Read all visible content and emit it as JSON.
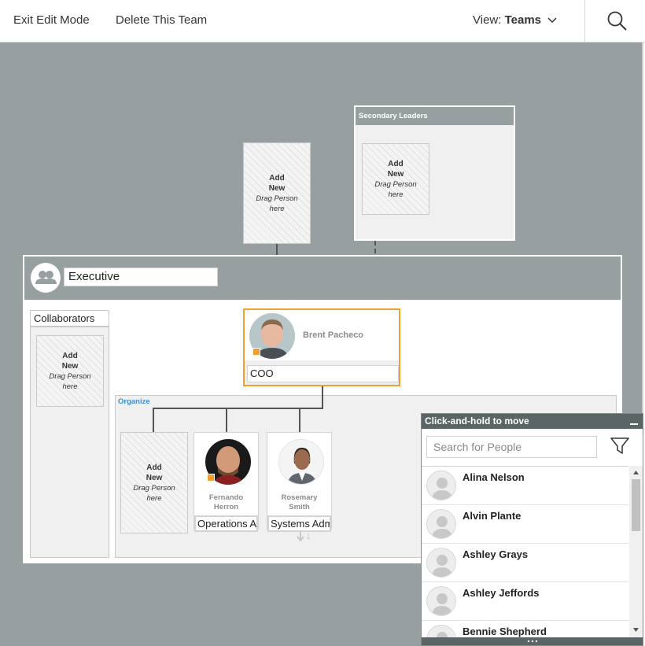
{
  "toolbar": {
    "exit_edit_label": "Exit Edit Mode",
    "delete_team_label": "Delete This Team",
    "view_prefix": "View:",
    "view_value": "Teams"
  },
  "placeholder": {
    "add": "Add",
    "new": "New",
    "drag_line1": "Drag Person",
    "drag_line2": "here"
  },
  "secondary_leaders": {
    "title": "Secondary Leaders"
  },
  "team": {
    "name": "Executive"
  },
  "collaborators": {
    "title": "Collaborators"
  },
  "leader": {
    "name": "Brent Pacheco",
    "role": "COO"
  },
  "organize": {
    "title": "Organize"
  },
  "members": [
    {
      "name_line1": "Fernando",
      "name_line2": "Herron",
      "role": "Operations Assistant"
    },
    {
      "name_line1": "Rosemary",
      "name_line2": "Smith",
      "role": "Systems Administrator",
      "reports_count": "1"
    }
  ],
  "people_panel": {
    "header": "Click-and-hold to move",
    "search_placeholder": "Search for People",
    "people": [
      {
        "name": "Alina Nelson"
      },
      {
        "name": "Alvin Plante"
      },
      {
        "name": "Ashley Grays"
      },
      {
        "name": "Ashley Jeffords"
      },
      {
        "name": "Bennie Shepherd"
      }
    ]
  },
  "colors": {
    "canvas": "#979fa0",
    "accent_leader_border": "#f0a030",
    "organize_title": "#3a8fd6",
    "panel_header": "#5b6566"
  }
}
